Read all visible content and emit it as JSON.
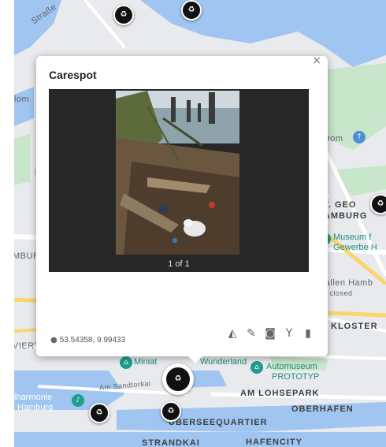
{
  "popup": {
    "title": "Carespot",
    "close_glyph": "×",
    "counter": "1 of 1",
    "coordinates": "53.54358, 9.99433",
    "tools": [
      {
        "icon": "paint-bucket-icon",
        "glyph": "◭"
      },
      {
        "icon": "pencil-icon",
        "glyph": "✎"
      },
      {
        "icon": "camera-icon",
        "glyph": "◙"
      },
      {
        "icon": "merge-icon",
        "glyph": "Y"
      },
      {
        "icon": "trash-icon",
        "glyph": "▮"
      }
    ]
  },
  "map": {
    "labels": {
      "street_top": "Straße",
      "st_georg": "ST. GEO",
      "hamburg": "HAMBURG",
      "museum1": "Museum f",
      "museum2": "Gewerbe H",
      "dom": "n-Dom",
      "hallen": "rhallen Hamb",
      "closed": "rily closed",
      "kloster": "KLOSTER",
      "miniatur": "Miniat",
      "wunderland": "Wunderland",
      "automuseum": "Automuseum",
      "prototyp": "PROTOTYP",
      "lohsepark": "AM LOHSEPARK",
      "oberhafen": "OBERHAFEN",
      "ueberseequartier": "ÜBERSEEQUARTIER",
      "strandkai": "STRANDKAI",
      "hafencity": "HAFENCITY",
      "elbphil1": "lharmonie",
      "elbphil2": "Hamburg",
      "sandtor": "Am Sandtorkai",
      "blom": "lom",
      "mbur": "MBUR",
      "vier": "VIERT"
    },
    "colors": {
      "water": "#9fc5f0",
      "land": "#e8eaed",
      "park": "#c8e6c9",
      "road": "#ffffff",
      "highway": "#fbd56b"
    }
  }
}
